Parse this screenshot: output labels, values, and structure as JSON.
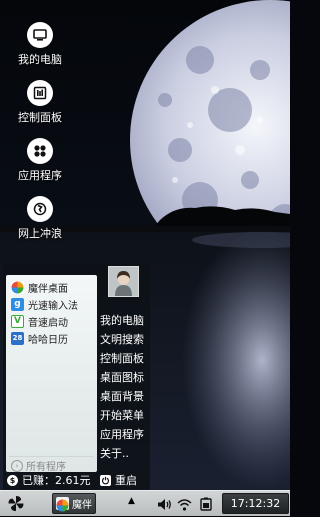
{
  "desktop": {
    "icons": [
      {
        "label": "我的电脑",
        "icon": "computer-icon"
      },
      {
        "label": "控制面板",
        "icon": "control-panel-icon"
      },
      {
        "label": "应用程序",
        "icon": "apps-icon"
      },
      {
        "label": "网上冲浪",
        "icon": "globe-icon"
      }
    ]
  },
  "start_menu": {
    "apps": [
      {
        "label": "魔伴桌面",
        "icon": "pinwheel-icon",
        "color": "#f39c12"
      },
      {
        "label": "光速输入法",
        "icon": "g-keyboard-icon",
        "color": "#2f8de4"
      },
      {
        "label": "音速启动",
        "icon": "v-launcher-icon",
        "color": "#3aa935"
      },
      {
        "label": "哈哈日历",
        "icon": "calendar-icon",
        "color": "#2a6fc9"
      }
    ],
    "all_programs": "所有程序",
    "right_items": [
      "我的电脑",
      "文明搜索",
      "控制面板",
      "桌面图标",
      "桌面背景",
      "开始菜单",
      "应用程序",
      "关于.."
    ],
    "earned": "已赚：2.61元",
    "restart": "重启"
  },
  "taskbar": {
    "task_label": "魔伴",
    "clock": "17:12:32"
  }
}
